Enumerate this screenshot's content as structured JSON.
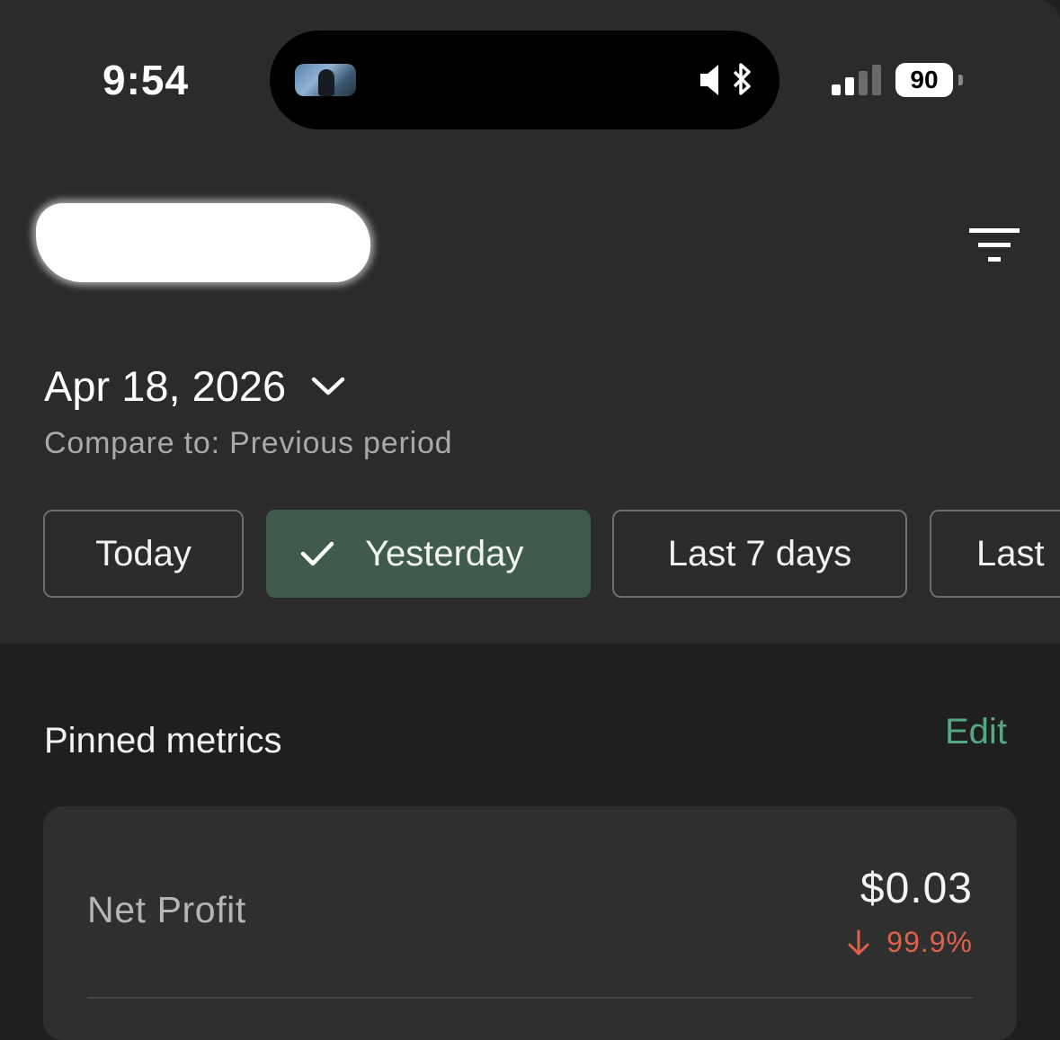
{
  "status_bar": {
    "time": "9:54",
    "battery": "90"
  },
  "header": {
    "store_name_redacted": true,
    "filter_icon": "filter-lines-icon"
  },
  "date_picker": {
    "date": "Apr 18, 2026",
    "compare": "Compare to: Previous period"
  },
  "ranges": [
    {
      "label": "Today",
      "selected": false
    },
    {
      "label": "Yesterday",
      "selected": true
    },
    {
      "label": "Last 7 days",
      "selected": false
    },
    {
      "label": "Last",
      "selected": false
    }
  ],
  "pinned": {
    "title": "Pinned metrics",
    "edit_label": "Edit",
    "metrics": [
      {
        "label": "Net Profit",
        "value": "$0.03",
        "change": "99.9%",
        "direction": "down"
      }
    ]
  },
  "colors": {
    "accent": "#56a884",
    "selected_chip": "#3e5b4b",
    "negative": "#e0614a"
  }
}
